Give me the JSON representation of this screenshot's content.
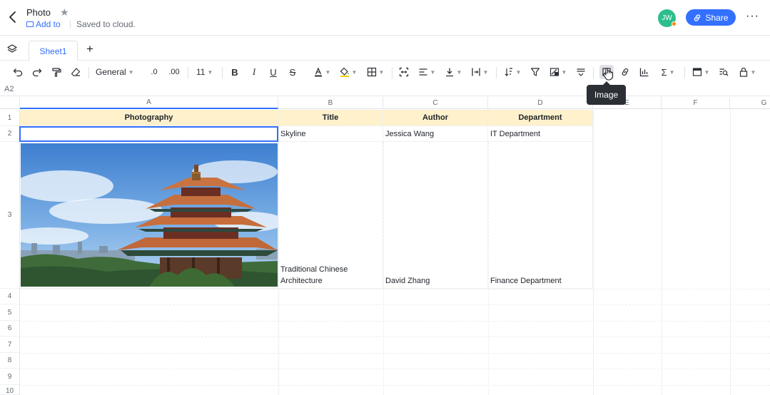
{
  "header": {
    "title": "Photo",
    "add_to": "Add to",
    "saved": "Saved to cloud.",
    "avatar_initials": "JW",
    "share_label": "Share",
    "more": "···"
  },
  "tabs": {
    "sheets": [
      {
        "label": "Sheet1"
      }
    ],
    "add": "+"
  },
  "toolbar": {
    "number_format": "General",
    "decrease_decimal": ".0",
    "increase_decimal": ".00",
    "font_size": "11"
  },
  "tooltip": "Image",
  "formula_bar": {
    "cell_ref": "A2"
  },
  "grid": {
    "columns": [
      "A",
      "B",
      "C",
      "D",
      "E",
      "F",
      "G"
    ],
    "rows": [
      "1",
      "2",
      "3",
      "4",
      "5",
      "6",
      "7",
      "8",
      "9",
      "10"
    ],
    "header_row": [
      "Photography",
      "Title",
      "Author",
      "Department"
    ],
    "row2": [
      "",
      "Skyline",
      "Jessica Wang",
      "IT Department"
    ],
    "row3": [
      "",
      "Traditional Chinese Architecture",
      "David Zhang",
      "Finance Department"
    ]
  },
  "colors": {
    "accent": "#3370ff",
    "header_fill": "#fef1cc",
    "avatar": "#2dbe8e"
  }
}
